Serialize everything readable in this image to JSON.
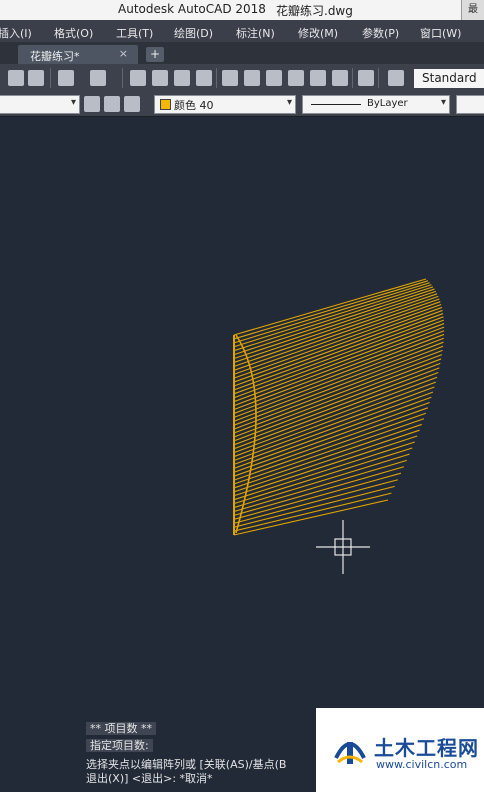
{
  "window": {
    "app_title": "Autodesk AutoCAD 2018",
    "file_title": "花瓣练习.dwg",
    "title_button_glyph": "最"
  },
  "menu": {
    "items": [
      "插入(I)",
      "格式(O)",
      "工具(T)",
      "绘图(D)",
      "标注(N)",
      "修改(M)",
      "参数(P)",
      "窗口(W)"
    ]
  },
  "tabs": {
    "active_label": "花瓣练习*",
    "close_glyph": "×",
    "new_tab_glyph": "+"
  },
  "toolbar": {
    "text_style": "Standard"
  },
  "properties": {
    "color_label": "颜色 40",
    "color_swatch": "#f5b800",
    "linetype_label": "ByLayer"
  },
  "drawing": {
    "line_color": "#e0a400",
    "fan_line_count": 52,
    "cursor_color": "#e6e6e6"
  },
  "command": {
    "line1": "** 项目数 **",
    "line2": "指定项目数:",
    "line3": "选择夹点以编辑阵列或 [关联(AS)/基点(B",
    "line4": "退出(X)] <退出>: *取消*"
  },
  "watermark": {
    "name": "土木工程网",
    "url": "www.civilcn.com",
    "brand_color": "#1a4b97"
  }
}
